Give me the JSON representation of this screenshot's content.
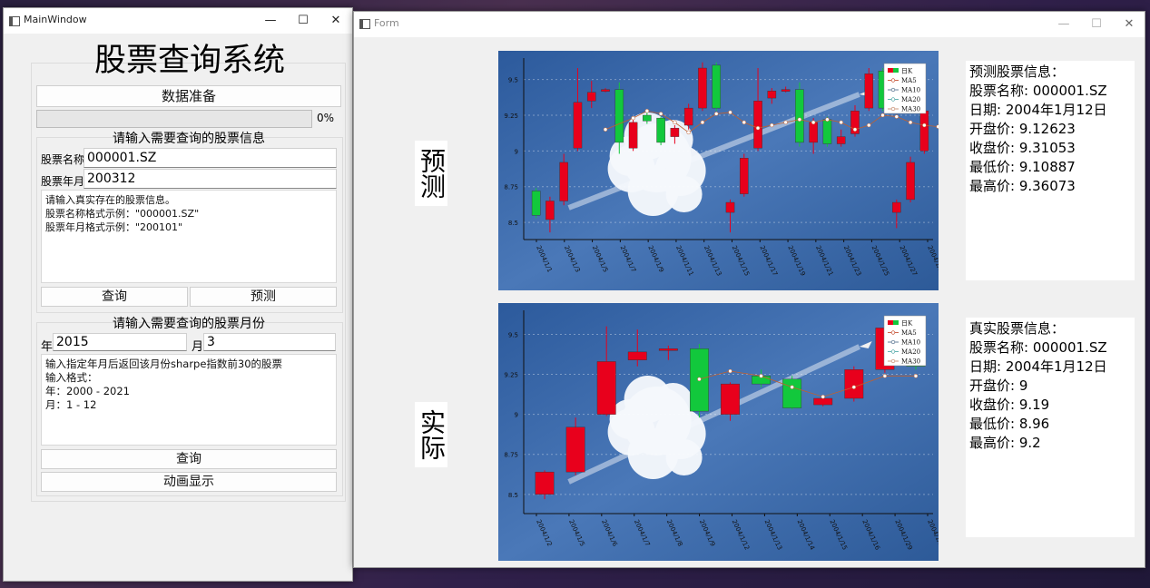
{
  "main_window": {
    "title": "MainWindow",
    "big_title": "股票查询系统",
    "data_prep_button": "数据准备",
    "progress_percent": 0,
    "progress_label": "0%",
    "stock_group": {
      "title": "请输入需要查询的股票信息",
      "name_label": "股票名称",
      "name_value": "000001.SZ",
      "month_label": "股票年月",
      "month_value": "200312",
      "hint_lines": [
        "请输入真实存在的股票信息。",
        "股票名称格式示例：\"000001.SZ\"",
        "股票年月格式示例：\"200101\""
      ],
      "query_button": "查询",
      "predict_button": "预测"
    },
    "month_group": {
      "title": "请输入需要查询的股票月份",
      "year_label": "年",
      "year_value": "2015",
      "month_label": "月",
      "month_value": "3",
      "hint_lines": [
        "输入指定年月后返回该月份sharpe指数前30的股票",
        "输入格式：",
        "年：2000 - 2021",
        "月：1 - 12"
      ],
      "query_button": "查询",
      "animate_button": "动画显示"
    }
  },
  "form_window": {
    "title": "Form",
    "predict_label": "预测",
    "actual_label": "实际",
    "predict_info": {
      "header": "预测股票信息：",
      "name": "股票名称: 000001.SZ",
      "date": "日期: 2004年1月12日",
      "open": "开盘价: 9.12623",
      "close": "收盘价: 9.31053",
      "low": "最低价: 9.10887",
      "high": "最高价: 9.36073"
    },
    "actual_info": {
      "header": "真实股票信息：",
      "name": "股票名称: 000001.SZ",
      "date": "日期: 2004年1月12日",
      "open": "开盘价: 9",
      "close": "收盘价: 9.19",
      "low": "最低价: 8.96",
      "high": "最高价: 9.2"
    }
  },
  "colors": {
    "up": "#e8001c",
    "down": "#12c83c",
    "plot_bg": "#3a67a8"
  },
  "chart_data": [
    {
      "type": "candlestick",
      "name": "predict",
      "ylim": [
        8.38,
        9.65
      ],
      "yticks": [
        8.5,
        8.75,
        9,
        9.25,
        9.5
      ],
      "ytick_labels": [
        "8.5",
        "8.75",
        "9",
        "9.25",
        "9.5"
      ],
      "legend": [
        "日K",
        "MA5",
        "MA10",
        "MA20",
        "MA30"
      ],
      "x_labels": [
        "2004/1/1",
        "2004/1/3",
        "2004/1/5",
        "2004/1/7",
        "2004/1/9",
        "2004/1/11",
        "2004/1/13",
        "2004/1/15",
        "2004/1/17",
        "2004/1/19",
        "2004/1/21",
        "2004/1/23",
        "2004/1/25",
        "2004/1/27",
        "2004/1/29"
      ],
      "candles": [
        {
          "o": 8.72,
          "c": 8.55,
          "h": 8.74,
          "l": 8.53
        },
        {
          "o": 8.52,
          "c": 8.65,
          "h": 8.68,
          "l": 8.43
        },
        {
          "o": 8.65,
          "c": 8.92,
          "h": 8.98,
          "l": 8.62
        },
        {
          "o": 9.02,
          "c": 9.34,
          "h": 9.58,
          "l": 9.0
        },
        {
          "o": 9.35,
          "c": 9.41,
          "h": 9.49,
          "l": 9.3
        },
        {
          "o": 9.42,
          "c": 9.43,
          "h": 9.44,
          "l": 9.41
        },
        {
          "o": 9.43,
          "c": 9.06,
          "h": 9.48,
          "l": 8.98
        },
        {
          "o": 9.02,
          "c": 9.2,
          "h": 9.23,
          "l": 9.0
        },
        {
          "o": 9.25,
          "c": 9.21,
          "h": 9.27,
          "l": 9.19
        },
        {
          "o": 9.23,
          "c": 9.06,
          "h": 9.24,
          "l": 9.04
        },
        {
          "o": 9.1,
          "c": 9.16,
          "h": 9.18,
          "l": 9.05
        },
        {
          "o": 9.18,
          "c": 9.3,
          "h": 9.33,
          "l": 9.15
        },
        {
          "o": 9.3,
          "c": 9.58,
          "h": 9.62,
          "l": 9.28
        },
        {
          "o": 9.6,
          "c": 9.3,
          "h": 9.62,
          "l": 9.28
        },
        {
          "o": 8.57,
          "c": 8.64,
          "h": 8.66,
          "l": 8.43
        },
        {
          "o": 8.7,
          "c": 8.95,
          "h": 8.98,
          "l": 8.68
        },
        {
          "o": 9.02,
          "c": 9.35,
          "h": 9.58,
          "l": 9.0
        },
        {
          "o": 9.37,
          "c": 9.42,
          "h": 9.44,
          "l": 9.33
        },
        {
          "o": 9.42,
          "c": 9.43,
          "h": 9.45,
          "l": 9.41
        },
        {
          "o": 9.43,
          "c": 9.06,
          "h": 9.48,
          "l": 9.03
        },
        {
          "o": 9.06,
          "c": 9.2,
          "h": 9.23,
          "l": 8.98
        },
        {
          "o": 9.22,
          "c": 9.05,
          "h": 9.24,
          "l": 9.03
        },
        {
          "o": 9.05,
          "c": 9.1,
          "h": 9.15,
          "l": 9.03
        },
        {
          "o": 9.12,
          "c": 9.28,
          "h": 9.32,
          "l": 9.1
        },
        {
          "o": 9.3,
          "c": 9.54,
          "h": 9.58,
          "l": 9.28
        },
        {
          "o": 9.56,
          "c": 9.3,
          "h": 9.58,
          "l": 9.28
        },
        {
          "o": 8.57,
          "c": 8.64,
          "h": 8.66,
          "l": 8.46
        },
        {
          "o": 8.66,
          "c": 8.92,
          "h": 8.96,
          "l": 8.64
        },
        {
          "o": 9.0,
          "c": 9.28,
          "h": 9.32,
          "l": 8.98
        }
      ],
      "ma": [
        {
          "x": 5,
          "v": 9.15
        },
        {
          "x": 7,
          "v": 9.23
        },
        {
          "x": 8,
          "v": 9.28
        },
        {
          "x": 9,
          "v": 9.26
        },
        {
          "x": 10,
          "v": 9.2
        },
        {
          "x": 11,
          "v": 9.13
        },
        {
          "x": 12,
          "v": 9.2
        },
        {
          "x": 13,
          "v": 9.26
        },
        {
          "x": 14,
          "v": 9.27
        },
        {
          "x": 15,
          "v": 9.2
        },
        {
          "x": 16,
          "v": 9.16
        },
        {
          "x": 17,
          "v": 9.18
        },
        {
          "x": 18,
          "v": 9.2
        },
        {
          "x": 19,
          "v": 9.22
        },
        {
          "x": 20,
          "v": 9.2
        },
        {
          "x": 21,
          "v": 9.22
        },
        {
          "x": 22,
          "v": 9.2
        },
        {
          "x": 23,
          "v": 9.15
        },
        {
          "x": 24,
          "v": 9.18
        },
        {
          "x": 25,
          "v": 9.25
        },
        {
          "x": 26,
          "v": 9.24
        },
        {
          "x": 27,
          "v": 9.2
        },
        {
          "x": 28,
          "v": 9.18
        },
        {
          "x": 29,
          "v": 9.17
        }
      ]
    },
    {
      "type": "candlestick",
      "name": "actual",
      "ylim": [
        8.38,
        9.65
      ],
      "yticks": [
        8.5,
        8.75,
        9,
        9.25,
        9.5
      ],
      "ytick_labels": [
        "8.5",
        "8.75",
        "9",
        "9.25",
        "9.5"
      ],
      "legend": [
        "日K",
        "MA5",
        "MA10",
        "MA20",
        "MA30"
      ],
      "x_labels": [
        "2004/1/2",
        "2004/1/5",
        "2004/1/6",
        "2004/1/7",
        "2004/1/8",
        "2004/1/9",
        "2004/1/12",
        "2004/1/13",
        "2004/1/14",
        "2004/1/15",
        "2004/1/16",
        "2004/1/29",
        "2004/1/30"
      ],
      "candles": [
        {
          "o": 8.5,
          "c": 8.64,
          "h": 8.65,
          "l": 8.47
        },
        {
          "o": 8.64,
          "c": 8.92,
          "h": 8.98,
          "l": 8.62
        },
        {
          "o": 9.0,
          "c": 9.33,
          "h": 9.55,
          "l": 8.99
        },
        {
          "o": 9.34,
          "c": 9.39,
          "h": 9.53,
          "l": 9.3
        },
        {
          "o": 9.4,
          "c": 9.41,
          "h": 9.43,
          "l": 9.34
        },
        {
          "o": 9.41,
          "c": 9.02,
          "h": 9.44,
          "l": 8.98
        },
        {
          "o": 9.0,
          "c": 9.19,
          "h": 9.2,
          "l": 8.96
        },
        {
          "o": 9.24,
          "c": 9.19,
          "h": 9.28,
          "l": 9.17
        },
        {
          "o": 9.22,
          "c": 9.04,
          "h": 9.24,
          "l": 9.03
        },
        {
          "o": 9.06,
          "c": 9.1,
          "h": 9.12,
          "l": 9.05
        },
        {
          "o": 9.1,
          "c": 9.28,
          "h": 9.3,
          "l": 9.08
        },
        {
          "o": 9.28,
          "c": 9.54,
          "h": 9.56,
          "l": 9.26
        },
        {
          "o": 9.55,
          "c": 9.3,
          "h": 9.57,
          "l": 9.28
        }
      ],
      "ma": [
        {
          "x": 5,
          "v": 9.22
        },
        {
          "x": 6,
          "v": 9.27
        },
        {
          "x": 7,
          "v": 9.24
        },
        {
          "x": 8,
          "v": 9.17
        },
        {
          "x": 9,
          "v": 9.11
        },
        {
          "x": 10,
          "v": 9.17
        },
        {
          "x": 11,
          "v": 9.24
        },
        {
          "x": 12,
          "v": 9.24
        }
      ]
    }
  ]
}
